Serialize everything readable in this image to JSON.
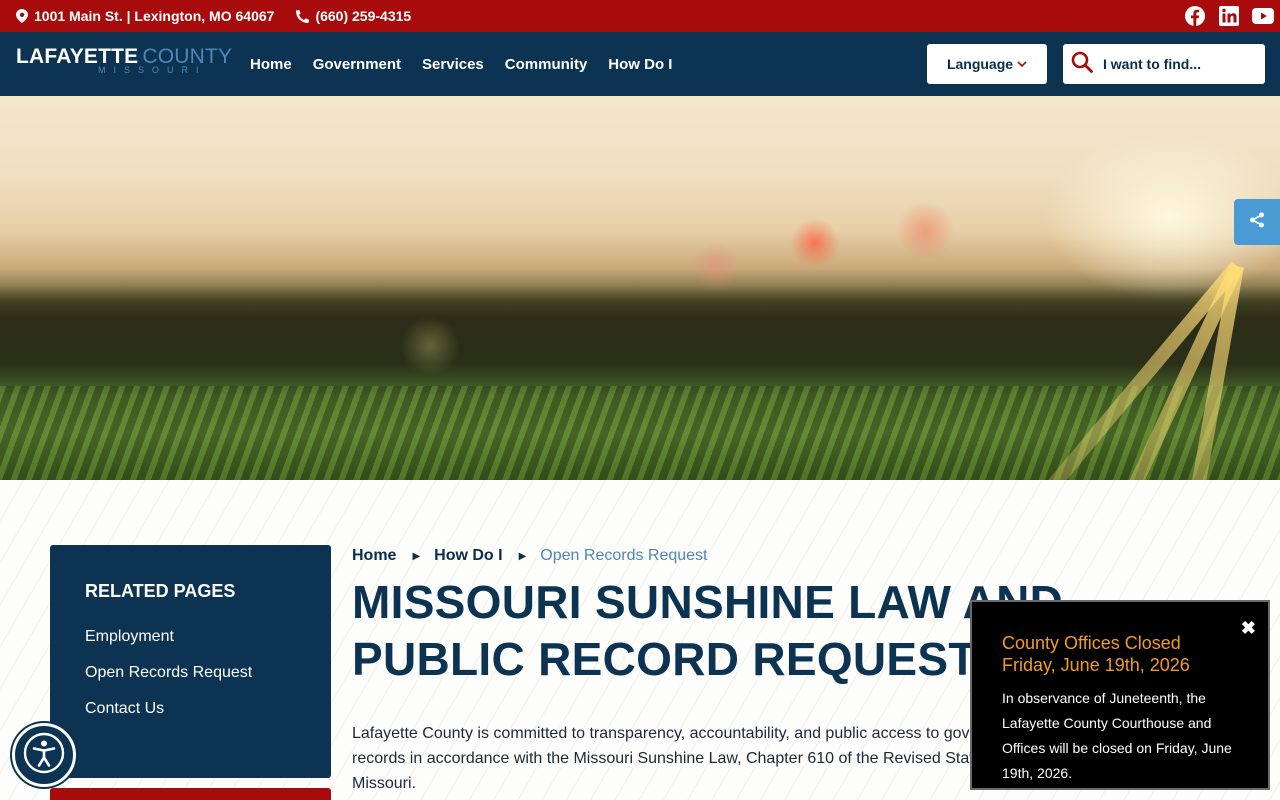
{
  "topbar": {
    "address": "1001 Main St. | Lexington, MO 64067",
    "phone": "(660) 259-4315",
    "social": [
      "facebook-icon",
      "linkedin-icon",
      "youtube-icon"
    ],
    "bg_color": "#a80b0b"
  },
  "header": {
    "logo_main": "LAFAYETTE",
    "logo_county": "COUNTY",
    "logo_state": "MISSOURI",
    "nav": [
      "Home",
      "Government",
      "Services",
      "Community",
      "How Do I"
    ],
    "language_label": "Language",
    "search_placeholder": "I want to find...",
    "bg_color": "#0c3352"
  },
  "sidebar": {
    "heading": "RELATED PAGES",
    "links": [
      "Employment",
      "Open Records Request",
      "Contact Us"
    ]
  },
  "breadcrumb": {
    "items": [
      "Home",
      "How Do I"
    ],
    "current": "Open Records Request"
  },
  "main": {
    "title": "MISSOURI SUNSHINE LAW AND PUBLIC RECORD REQUESTS",
    "intro": "Lafayette County is committed to transparency, accountability, and public access to government records in accordance with the Missouri Sunshine Law, Chapter 610 of the Revised Statutes of Missouri."
  },
  "alert": {
    "title": "County Offices Closed Friday, June 19th, 2026",
    "body": "In observance of Juneteenth, the Lafayette County Courthouse and Offices will be closed on Friday, June 19th, 2026.",
    "close": "✖",
    "title_color": "#f39c1f"
  }
}
